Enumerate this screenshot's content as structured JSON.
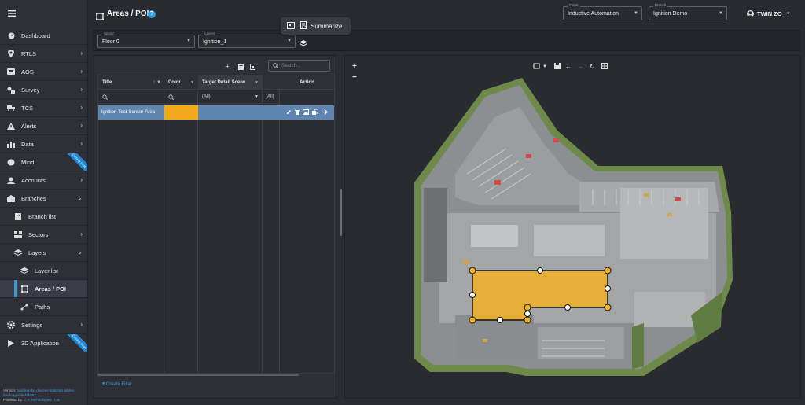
{
  "header": {
    "title": "Areas / POI",
    "help": "?",
    "summarize": "Summarize",
    "client_label": "Client",
    "client_value": "Inductive Automation",
    "branch_label": "Branch",
    "branch_value": "Ignition Demo",
    "user": "TWIN ZO"
  },
  "sidebar": {
    "items": [
      {
        "label": "Dashboard"
      },
      {
        "label": "RTLS"
      },
      {
        "label": "AOS"
      },
      {
        "label": "Survey"
      },
      {
        "label": "TCS"
      },
      {
        "label": "Alerts"
      },
      {
        "label": "Data"
      },
      {
        "label": "Mind"
      },
      {
        "label": "Accounts"
      },
      {
        "label": "Branches"
      },
      {
        "label": "Branch list"
      },
      {
        "label": "Sectors"
      },
      {
        "label": "Layers"
      },
      {
        "label": "Layer list"
      },
      {
        "label": "Areas / POI"
      },
      {
        "label": "Paths"
      },
      {
        "label": "Settings"
      },
      {
        "label": "3D Application"
      }
    ],
    "ribbon": "Coming Soon",
    "footer_version_label": "Version:",
    "footer_version": "building-the-devices-statistics-tables",
    "footer_line2": "live-long-side-fab397",
    "footer_powered_label": "Powered by:",
    "footer_powered": "C.A. technologies | L.a."
  },
  "filters": {
    "sector_label": "Sector",
    "sector_value": "Floor 0",
    "layers_label": "Layers",
    "layers_value": "Ignition_1"
  },
  "table": {
    "search_placeholder": "Search...",
    "columns": {
      "title": "Title",
      "color": "Color",
      "target": "Target Detail Scene",
      "action": "Action"
    },
    "filter_all": "(All)",
    "filter_all2": "(All)",
    "rows": [
      {
        "title": "Ignition-Test-Sensor-Area",
        "color": "#f2a91b"
      }
    ],
    "create_filter": "Create Filter"
  },
  "map": {
    "zoom_in": "+",
    "zoom_out": "−",
    "area_color": "#f2b125"
  }
}
